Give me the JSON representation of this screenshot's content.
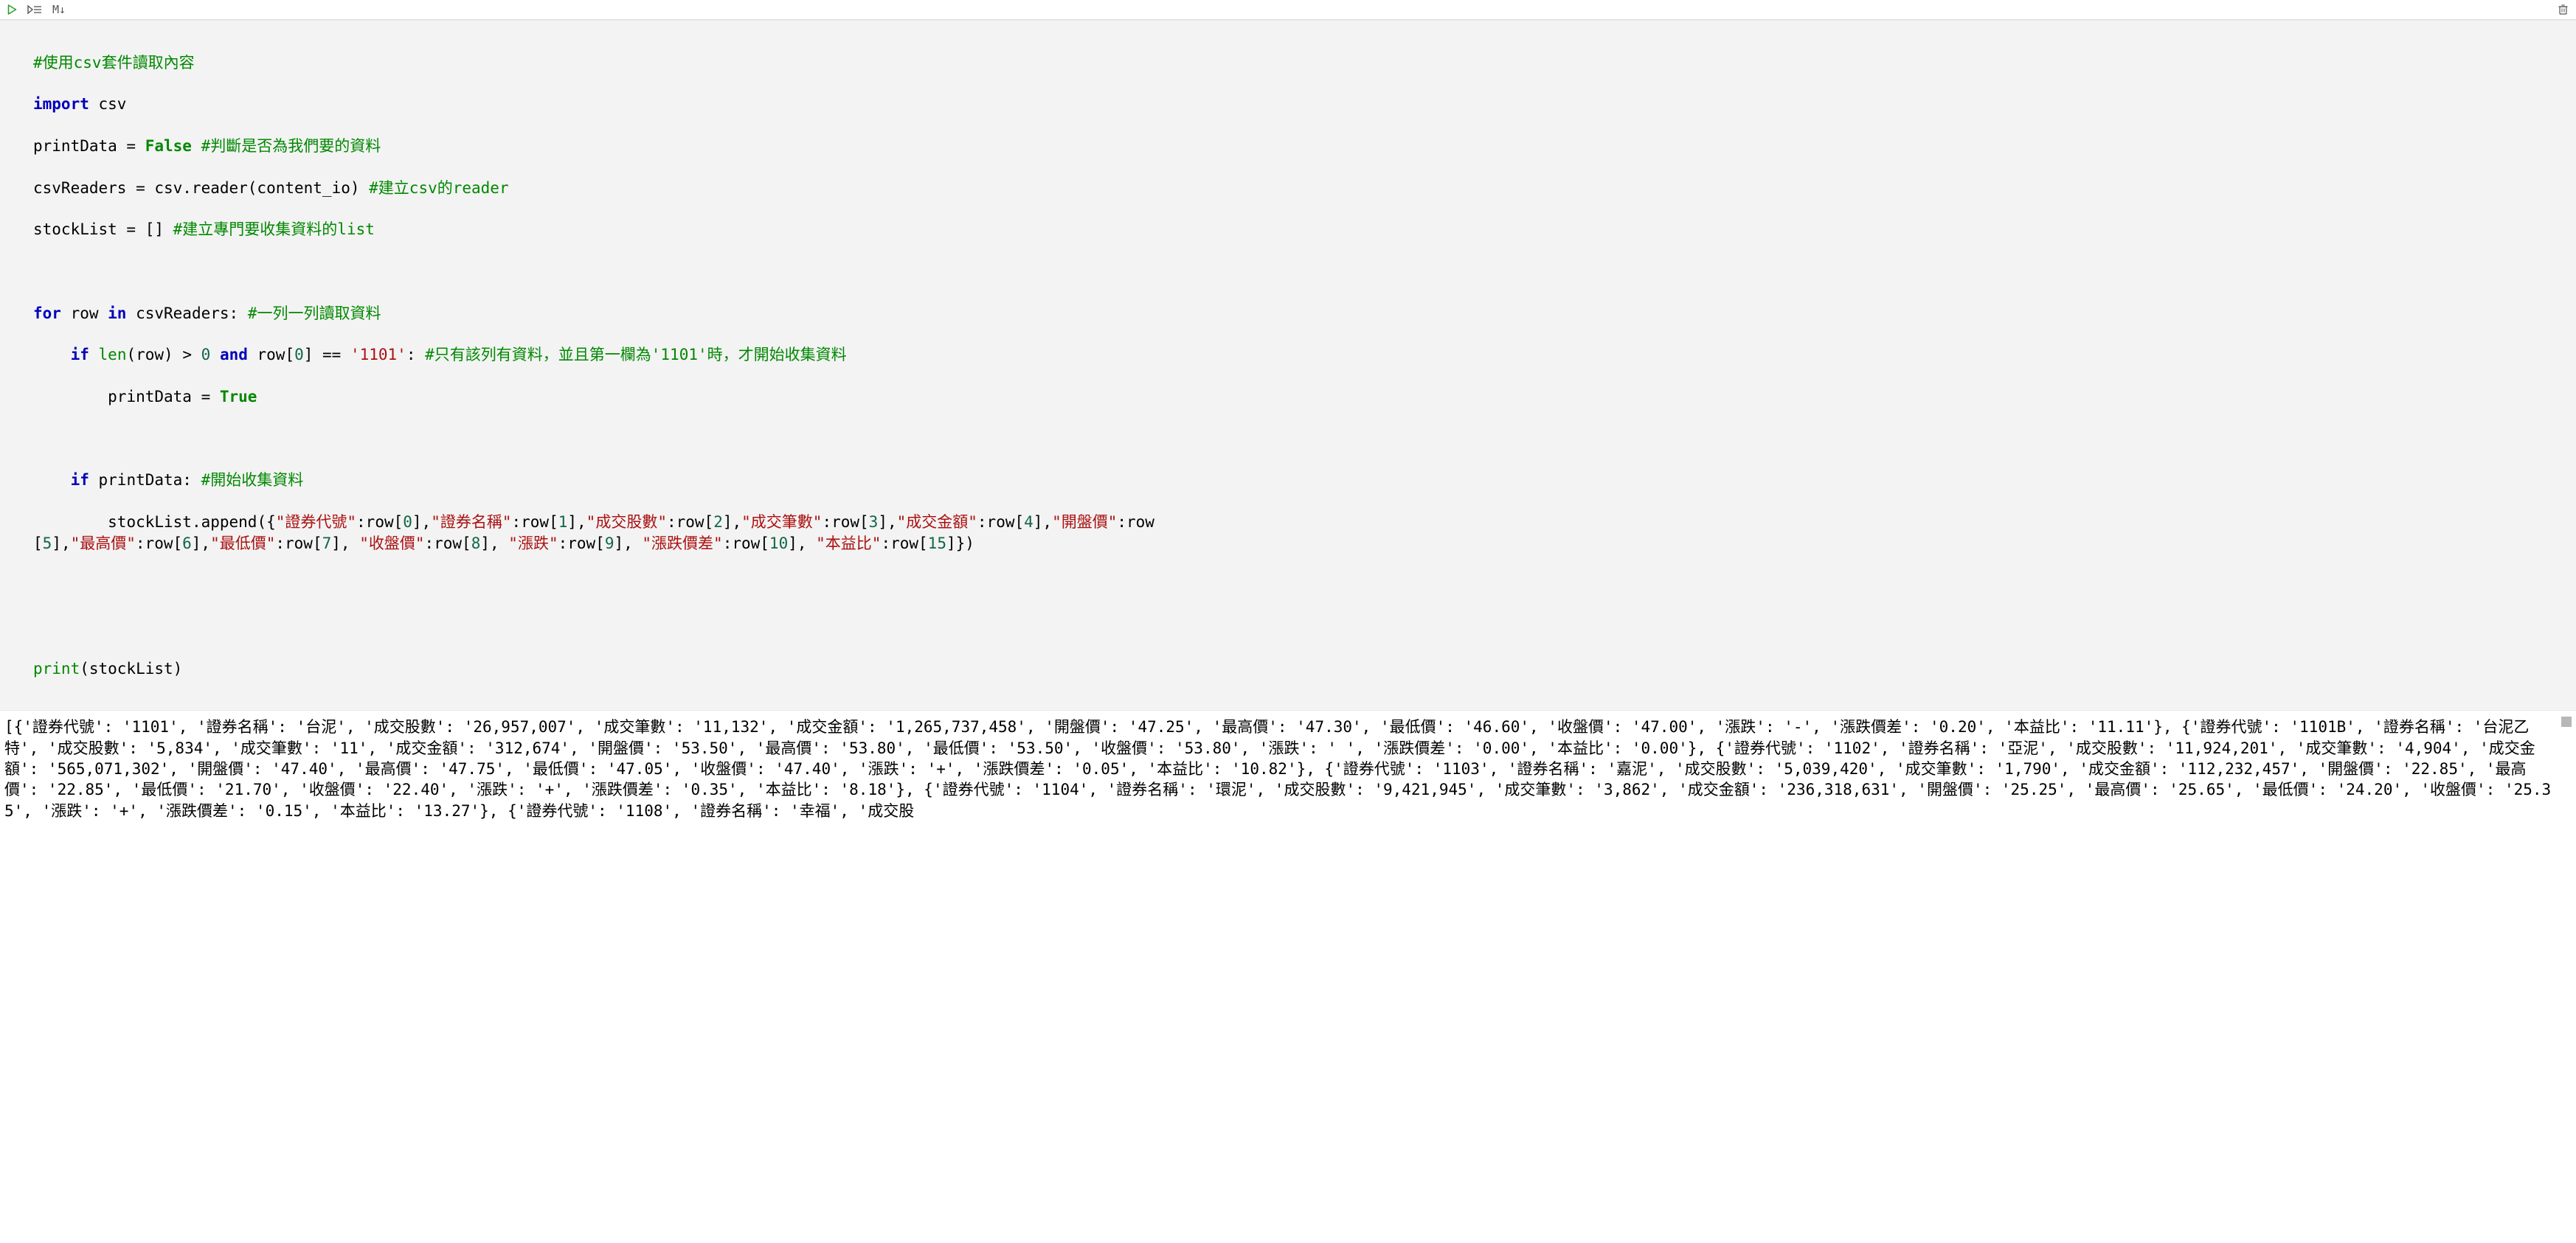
{
  "toolbar": {
    "run_label": "",
    "step_label": "",
    "markdown_label": "M↓",
    "delete_label": ""
  },
  "code": {
    "l0_comment": "#使用csv套件讀取內容",
    "l1_kw": "import",
    "l1_mod": " csv",
    "l2_a": "printData = ",
    "l2_kw": "False",
    "l2_sp": " ",
    "l2_comment": "#判斷是否為我們要的資料",
    "l3_a": "csvReaders = csv.reader(content_io) ",
    "l3_comment": "#建立csv的reader",
    "l4_a": "stockList = [] ",
    "l4_comment": "#建立專門要收集資料的list",
    "l6_kw_for": "for",
    "l6_a": " row ",
    "l6_kw_in": "in",
    "l6_b": " csvReaders: ",
    "l6_comment": "#一列一列讀取資料",
    "l7_indent": "    ",
    "l7_kw_if": "if",
    "l7_a": " ",
    "l7_len": "len",
    "l7_b": "(row) > ",
    "l7_num0": "0",
    "l7_c": " ",
    "l7_kw_and": "and",
    "l7_d": " row[",
    "l7_idx0": "0",
    "l7_e": "] == ",
    "l7_str": "'1101'",
    "l7_f": ": ",
    "l7_comment": "#只有該列有資料，並且第一欄為'1101'時，才開始收集資料",
    "l8_indent": "        ",
    "l8_a": "printData = ",
    "l8_kw": "True",
    "l10_indent": "    ",
    "l10_kw_if": "if",
    "l10_a": " printData: ",
    "l10_comment": "#開始收集資料",
    "l11_indent": "        ",
    "l11_a": "stockList.append({",
    "l11_s1": "\"證券代號\"",
    "l11_b": ":row[",
    "l11_i0": "0",
    "l11_c": "],",
    "l11_s2": "\"證券名稱\"",
    "l11_d": ":row[",
    "l11_i1": "1",
    "l11_e": "],",
    "l11_s3": "\"成交股數\"",
    "l11_f": ":row[",
    "l11_i2": "2",
    "l11_g": "],",
    "l11_s4": "\"成交筆數\"",
    "l11_h": ":row[",
    "l11_i3": "3",
    "l11_i": "],",
    "l11_s5": "\"成交金額\"",
    "l11_j": ":row[",
    "l11_i4": "4",
    "l11_k": "],",
    "l11_s6": "\"開盤價\"",
    "l11_l": ":row",
    "l12_a": "[",
    "l12_i5": "5",
    "l12_b": "],",
    "l12_s7": "\"最高價\"",
    "l12_c": ":row[",
    "l12_i6": "6",
    "l12_d": "],",
    "l12_s8": "\"最低價\"",
    "l12_e": ":row[",
    "l12_i7": "7",
    "l12_f": "], ",
    "l12_s9": "\"收盤價\"",
    "l12_g": ":row[",
    "l12_i8": "8",
    "l12_h": "], ",
    "l12_s10": "\"漲跌\"",
    "l12_i": ":row[",
    "l12_i9": "9",
    "l12_j": "], ",
    "l12_s11": "\"漲跌價差\"",
    "l12_k": ":row[",
    "l12_i10": "10",
    "l12_l": "], ",
    "l12_s12": "\"本益比\"",
    "l12_m": ":row[",
    "l12_i15": "15",
    "l12_n": "]})",
    "l15_print": "print",
    "l15_a": "(stockList)"
  },
  "output_text": "[{'證券代號': '1101', '證券名稱': '台泥', '成交股數': '26,957,007', '成交筆數': '11,132', '成交金額': '1,265,737,458', '開盤價': '47.25', '最高價': '47.30', '最低價': '46.60', '收盤價': '47.00', '漲跌': '-', '漲跌價差': '0.20', '本益比': '11.11'}, {'證券代號': '1101B', '證券名稱': '台泥乙特', '成交股數': '5,834', '成交筆數': '11', '成交金額': '312,674', '開盤價': '53.50', '最高價': '53.80', '最低價': '53.50', '收盤價': '53.80', '漲跌': ' ', '漲跌價差': '0.00', '本益比': '0.00'}, {'證券代號': '1102', '證券名稱': '亞泥', '成交股數': '11,924,201', '成交筆數': '4,904', '成交金額': '565,071,302', '開盤價': '47.40', '最高價': '47.75', '最低價': '47.05', '收盤價': '47.40', '漲跌': '+', '漲跌價差': '0.05', '本益比': '10.82'}, {'證券代號': '1103', '證券名稱': '嘉泥', '成交股數': '5,039,420', '成交筆數': '1,790', '成交金額': '112,232,457', '開盤價': '22.85', '最高價': '22.85', '最低價': '21.70', '收盤價': '22.40', '漲跌': '+', '漲跌價差': '0.35', '本益比': '8.18'}, {'證券代號': '1104', '證券名稱': '環泥', '成交股數': '9,421,945', '成交筆數': '3,862', '成交金額': '236,318,631', '開盤價': '25.25', '最高價': '25.65', '最低價': '24.20', '收盤價': '25.35', '漲跌': '+', '漲跌價差': '0.15', '本益比': '13.27'}, {'證券代號': '1108', '證券名稱': '幸福', '成交股"
}
